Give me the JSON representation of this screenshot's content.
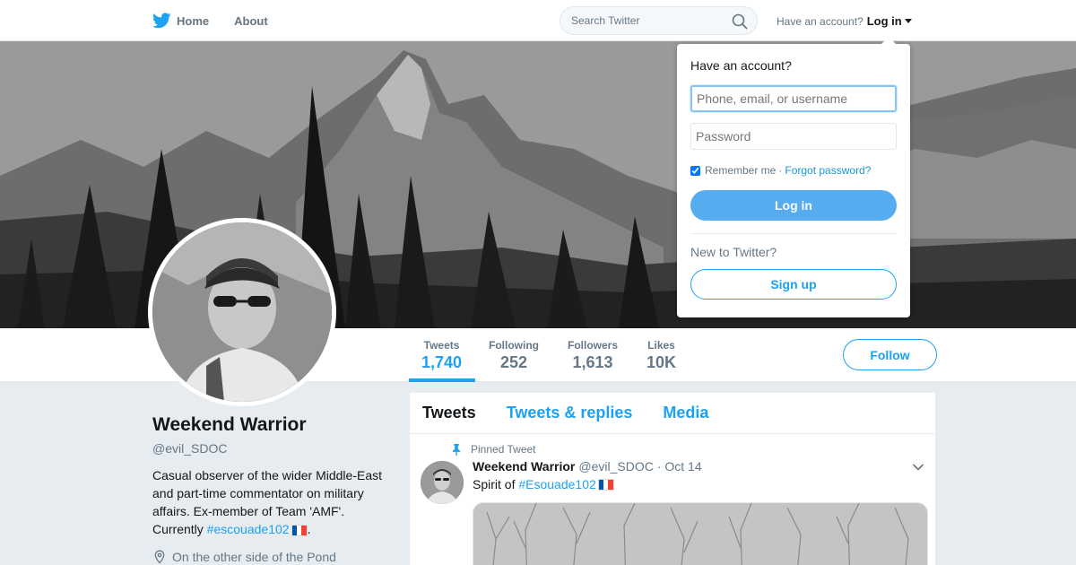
{
  "nav": {
    "home_label": "Home",
    "about_label": "About",
    "search_placeholder": "Search Twitter",
    "account_prompt": "Have an account?",
    "login_label": "Log in"
  },
  "login_dropdown": {
    "title": "Have an account?",
    "username_placeholder": "Phone, email, or username",
    "password_placeholder": "Password",
    "remember_label": "Remember me",
    "separator": "·",
    "forgot_label": "Forgot password?",
    "login_button": "Log in",
    "new_prompt": "New to Twitter?",
    "signup_button": "Sign up"
  },
  "stats": [
    {
      "label": "Tweets",
      "value": "1,740",
      "active": true
    },
    {
      "label": "Following",
      "value": "252",
      "active": false
    },
    {
      "label": "Followers",
      "value": "1,613",
      "active": false
    },
    {
      "label": "Likes",
      "value": "10K",
      "active": false
    }
  ],
  "follow_button": "Follow",
  "profile": {
    "name": "Weekend Warrior",
    "handle": "@evil_SDOC",
    "bio_text": "Casual observer of the wider Middle-East and part-time commentator on military affairs. Ex-member of Team 'AMF'. Currently",
    "bio_hashtag": "#escouade102",
    "bio_end": ".",
    "location": "On the other side of the Pond"
  },
  "timeline": {
    "tabs": [
      "Tweets",
      "Tweets & replies",
      "Media"
    ],
    "pinned_label": "Pinned Tweet",
    "tweet": {
      "name": "Weekend Warrior",
      "handle": "@evil_SDOC",
      "date": "· Oct 14",
      "text": "Spirit of",
      "hashtag": "#Esouade102"
    }
  },
  "colors": {
    "accent": "#1da1f2",
    "login_button": "#55acee",
    "flag_blue": "#0055a4",
    "flag_white": "#ffffff",
    "flag_red": "#ef4135"
  },
  "icons": [
    "twitter-bird-icon",
    "search-icon",
    "caret-down-icon",
    "location-pin-icon",
    "pin-icon",
    "chevron-down-icon",
    "flag-france-icon"
  ]
}
